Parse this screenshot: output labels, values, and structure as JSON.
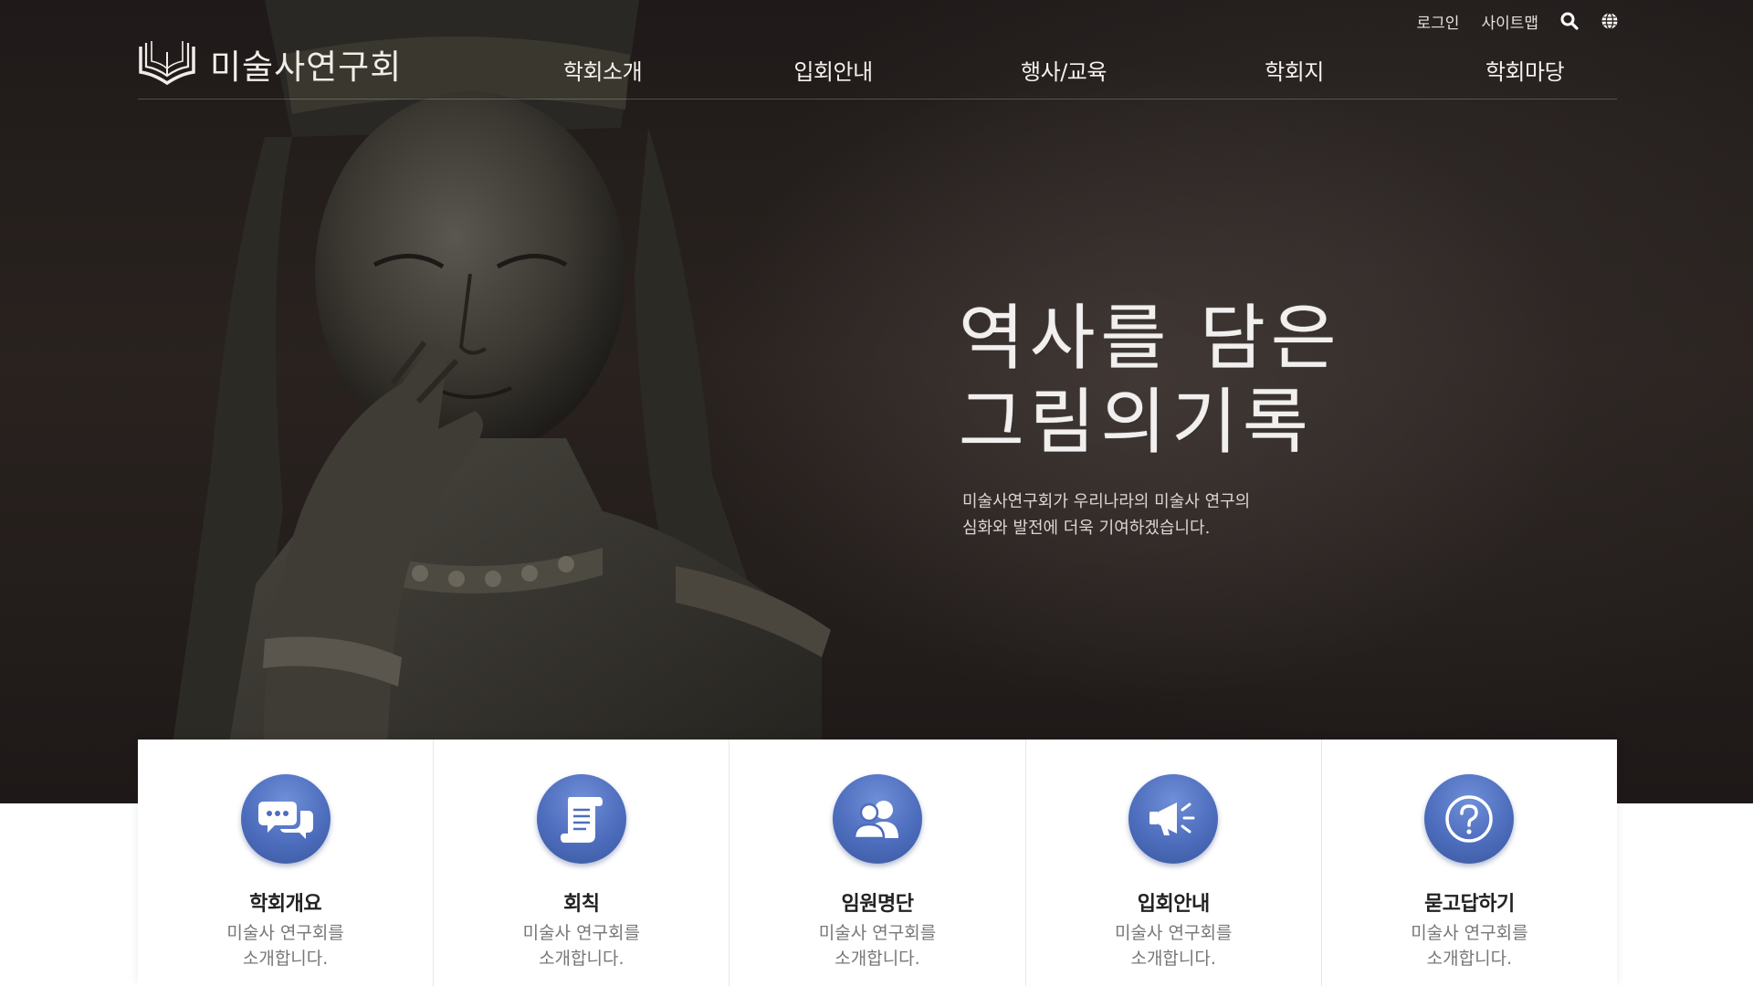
{
  "utility": {
    "login": "로그인",
    "sitemap": "사이트맵",
    "search_icon": "search-icon",
    "language_icon": "globe-icon"
  },
  "header": {
    "logo_text": "미술사연구회",
    "nav": [
      {
        "label": "학회소개"
      },
      {
        "label": "입회안내"
      },
      {
        "label": "행사/교육"
      },
      {
        "label": "학회지"
      },
      {
        "label": "학회마당"
      }
    ]
  },
  "hero": {
    "title_line1": "역사를 담은",
    "title_line2": "그림의기록",
    "subtitle_line1": "미술사연구회가 우리나라의 미술사 연구의",
    "subtitle_line2": "심화와 발전에 더욱 기여하겠습니다."
  },
  "cards": [
    {
      "icon": "chat-bubbles-icon",
      "title": "학회개요",
      "desc_line1": "미술사 연구회를",
      "desc_line2": "소개합니다."
    },
    {
      "icon": "scroll-document-icon",
      "title": "회칙",
      "desc_line1": "미술사 연구회를",
      "desc_line2": "소개합니다."
    },
    {
      "icon": "members-icon",
      "title": "임원명단",
      "desc_line1": "미술사 연구회를",
      "desc_line2": "소개합니다."
    },
    {
      "icon": "megaphone-icon",
      "title": "입회안내",
      "desc_line1": "미술사 연구회를",
      "desc_line2": "소개합니다."
    },
    {
      "icon": "question-icon",
      "title": "묻고답하기",
      "desc_line1": "미술사 연구회를",
      "desc_line2": "소개합니다."
    }
  ],
  "colors": {
    "hero_background": "#231d1b",
    "card_icon_blue": "#4d6dbd",
    "header_text": "#f4f1ee"
  }
}
